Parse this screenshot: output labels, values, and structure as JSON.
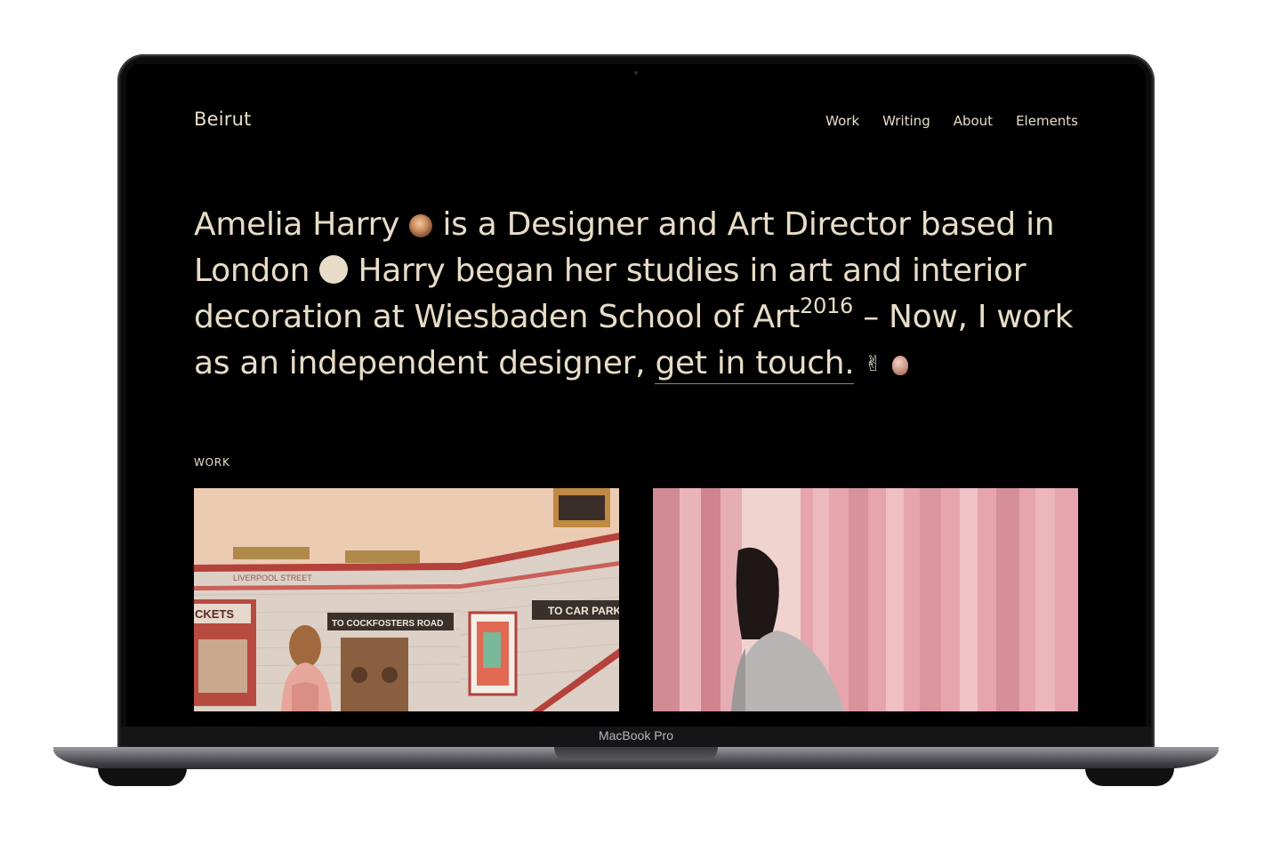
{
  "device": {
    "label": "MacBook Pro"
  },
  "site": {
    "logo": "Beirut",
    "nav": [
      {
        "label": "Work"
      },
      {
        "label": "Writing"
      },
      {
        "label": "About"
      },
      {
        "label": "Elements"
      }
    ]
  },
  "hero": {
    "part1": "Amelia Harry",
    "part2": "is a Designer and Art Director based in London",
    "part3": "Harry began her studies in art and interior decoration at Wiesbaden School of Art",
    "superscript": "2016",
    "part4": "– Now, I work as an independent designer,",
    "cta": "get in touch.",
    "emoji": "✌"
  },
  "work": {
    "label": "WORK",
    "cards": [
      {
        "signs": [
          "LIVERPOOL STREET",
          "CKETS",
          "TO COCKFOSTERS ROAD",
          "TO CAR PARK"
        ]
      },
      {}
    ]
  },
  "colors": {
    "text": "#e7dcc7",
    "background": "#000000"
  }
}
